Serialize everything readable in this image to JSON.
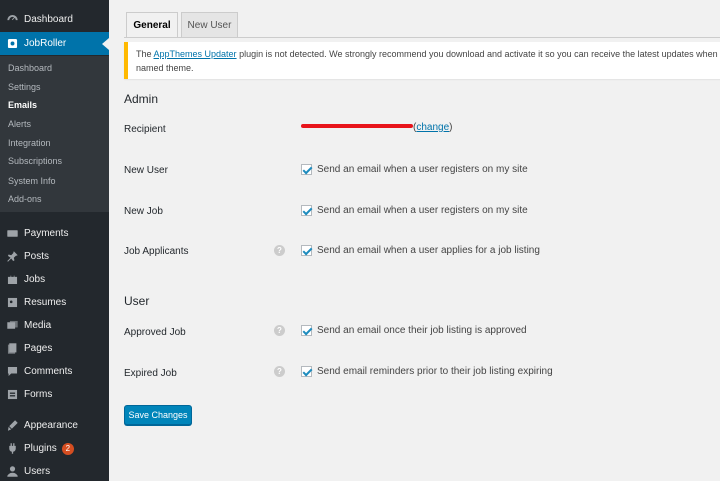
{
  "sidebar": {
    "top_items": [
      {
        "label": "Dashboard",
        "icon": "dashboard-icon"
      },
      {
        "label": "JobRoller",
        "icon": "jobroller-icon",
        "active": true
      }
    ],
    "submenu": [
      {
        "label": "Dashboard"
      },
      {
        "label": "Settings"
      },
      {
        "label": "Emails",
        "current": true
      },
      {
        "label": "Alerts"
      },
      {
        "label": "Integration"
      },
      {
        "label": "Subscriptions"
      },
      {
        "label": "System Info"
      },
      {
        "label": "Add-ons"
      }
    ],
    "items": [
      {
        "label": "Payments",
        "icon": "payments-icon"
      },
      {
        "label": "Posts",
        "icon": "pin-icon"
      },
      {
        "label": "Jobs",
        "icon": "jobs-icon"
      },
      {
        "label": "Resumes",
        "icon": "resumes-icon"
      },
      {
        "label": "Media",
        "icon": "media-icon"
      },
      {
        "label": "Pages",
        "icon": "pages-icon"
      },
      {
        "label": "Comments",
        "icon": "comments-icon"
      },
      {
        "label": "Forms",
        "icon": "forms-icon"
      },
      {
        "label": "Appearance",
        "icon": "appearance-icon"
      },
      {
        "label": "Plugins",
        "icon": "plugins-icon",
        "badge": "2"
      },
      {
        "label": "Users",
        "icon": "users-icon"
      }
    ]
  },
  "tabs": [
    {
      "label": "General",
      "active": true
    },
    {
      "label": "New User",
      "active": false
    }
  ],
  "notice": {
    "prefix": "The ",
    "link": "AppThemes Updater",
    "text": " plugin is not detected. We strongly recommend you download and activate it so you can receive the latest updates when ava",
    "line2": "named theme."
  },
  "admin": {
    "title": "Admin",
    "recipient_label": "Recipient",
    "change_link": "change",
    "rows": [
      {
        "label": "New User",
        "checkbox": "Send an email when a user registers on my site",
        "help": false
      },
      {
        "label": "New Job",
        "checkbox": "Send an email when a user registers on my site",
        "help": false
      },
      {
        "label": "Job Applicants",
        "checkbox": "Send an email when a user applies for a job listing",
        "help": true
      }
    ]
  },
  "user": {
    "title": "User",
    "rows": [
      {
        "label": "Approved Job",
        "checkbox": "Send an email once their job listing is approved",
        "help": true
      },
      {
        "label": "Expired Job",
        "checkbox": "Send email reminders prior to their job listing expiring",
        "help": true
      }
    ]
  },
  "save_label": "Save Changes",
  "help_glyph": "?",
  "colors": {
    "sidebar": "#23282d",
    "accent": "#0073aa",
    "notice_border": "#ffb900",
    "badge": "#d54e21"
  }
}
